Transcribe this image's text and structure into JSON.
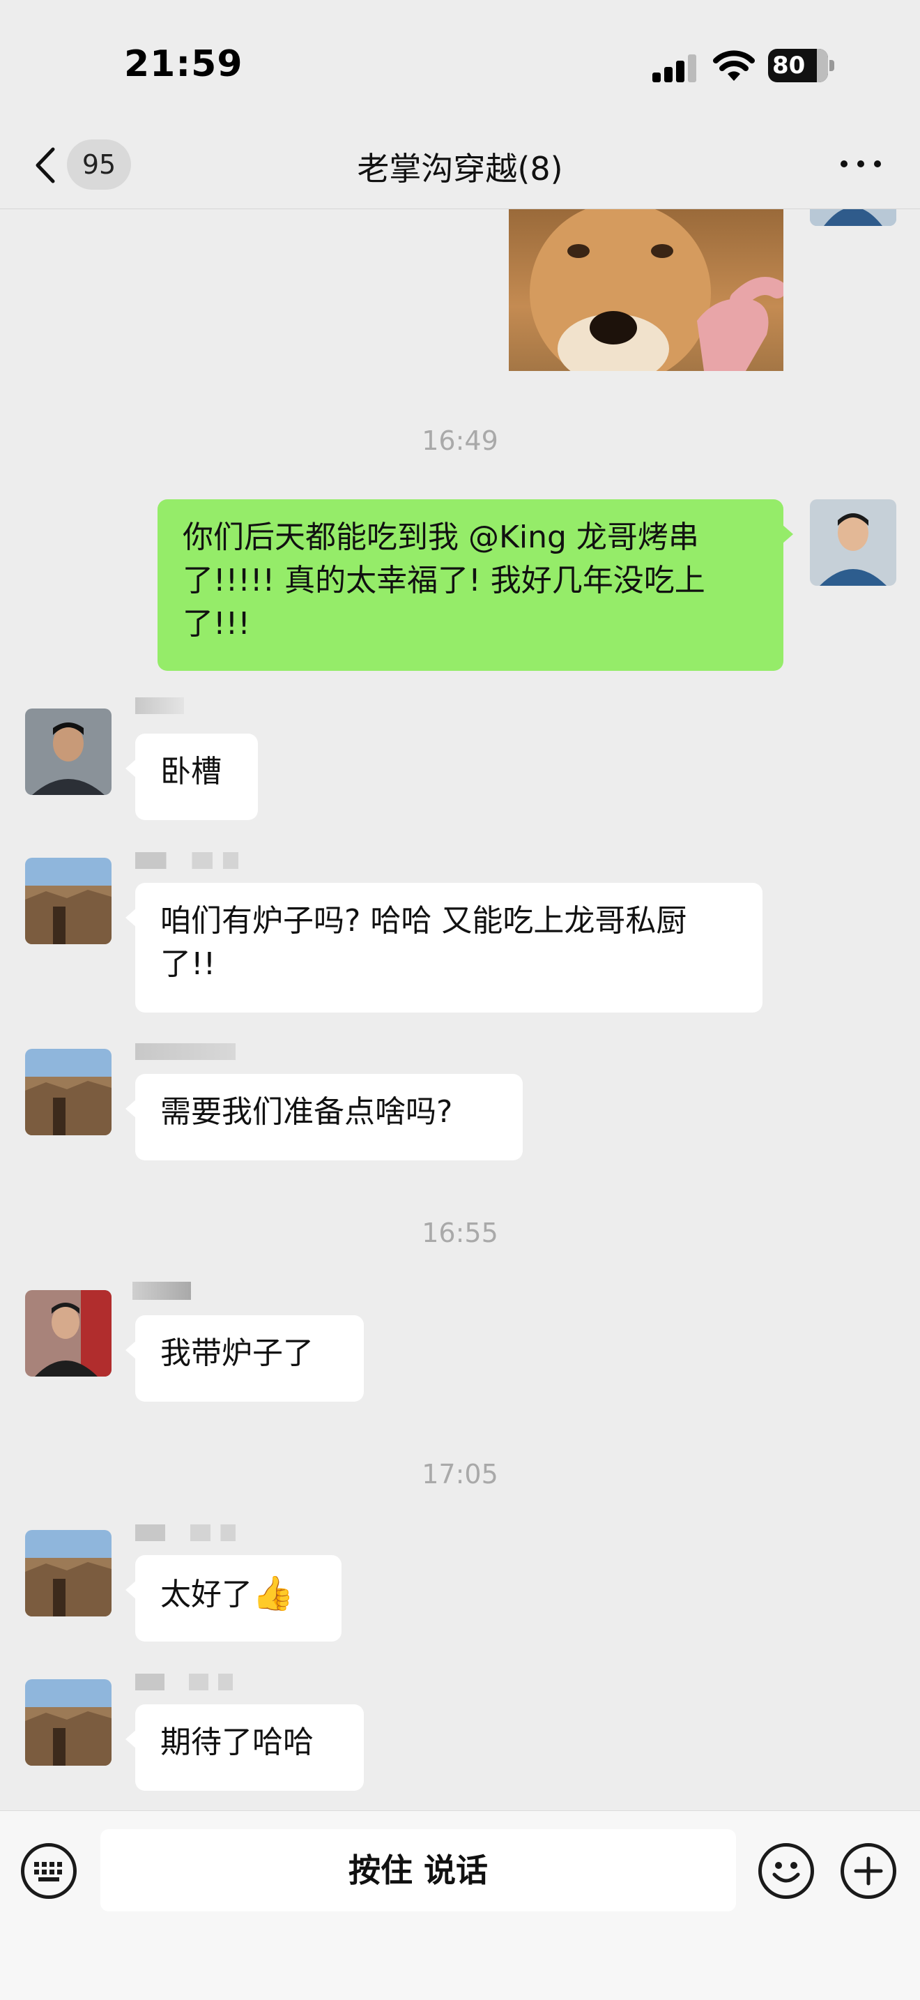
{
  "status_bar": {
    "time": "21:59",
    "battery": "80"
  },
  "nav": {
    "back_badge": "95",
    "title": "老掌沟穿越(8)"
  },
  "messages": {
    "ts1": "16:49",
    "msg1": "你们后天都能吃到我 @King 龙哥烤串了!!!!! 真的太幸福了! 我好几年没吃上了!!!",
    "msg2": "卧槽",
    "msg3": "咱们有炉子吗? 哈哈 又能吃上龙哥私厨了!!",
    "msg4": "需要我们准备点啥吗?",
    "ts2": "16:55",
    "msg5": "我带炉子了",
    "ts3": "17:05",
    "msg6": "太好了",
    "msg6_emoji": "👍",
    "msg7": "期待了哈哈"
  },
  "input_bar": {
    "hold_to_talk": "按住 说话"
  }
}
